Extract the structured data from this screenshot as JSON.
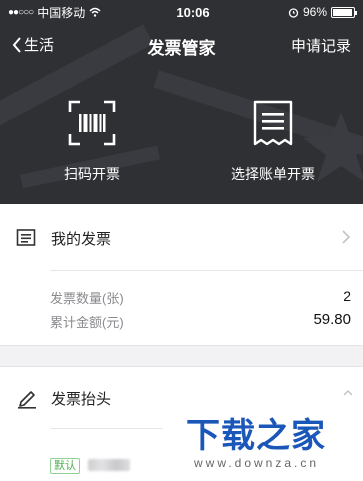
{
  "status_bar": {
    "signal_dots": "●●○○○",
    "carrier": "中国移动",
    "time": "10:06",
    "battery_percent": "96%",
    "battery_level": 0.96
  },
  "navbar": {
    "back_label": "生活",
    "title": "发票管家",
    "right_action": "申请记录"
  },
  "actions": [
    {
      "label": "扫码开票",
      "icon": "barcode-scan-icon"
    },
    {
      "label": "选择账单开票",
      "icon": "bill-receipt-icon"
    }
  ],
  "my_invoices": {
    "label": "我的发票",
    "icon": "invoice-list-icon",
    "stats": [
      {
        "label": "发票数量(张)",
        "value": "2"
      },
      {
        "label": "累计金额(元)",
        "value": "59.80"
      }
    ]
  },
  "invoice_header": {
    "label": "发票抬头",
    "icon": "pen-edit-icon",
    "default_tag": "默认"
  },
  "watermark": {
    "title": "下载之家",
    "url": "www.downza.cn"
  },
  "colors": {
    "hero_bg": "#2f3034",
    "accent_green": "#4caf50",
    "watermark_blue": "#1a57b8"
  }
}
